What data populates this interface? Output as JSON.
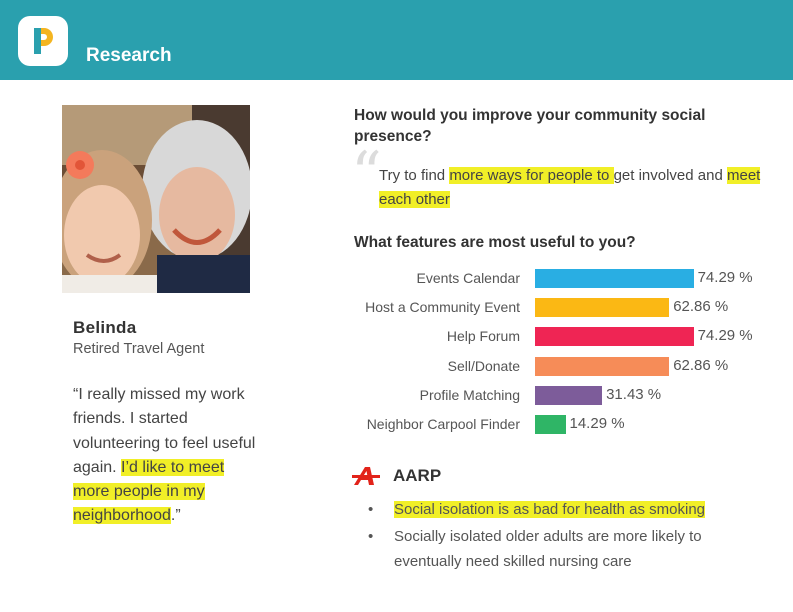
{
  "header": {
    "title": "Research",
    "logo_icon": "p-logo-icon"
  },
  "persona": {
    "name": "Belinda",
    "role": "Retired Travel Agent",
    "quote_plain": "“I really missed my work friends. I started volunteering to feel useful again. ",
    "quote_highlight": "I’d like to  meet more people in my neighborhood",
    "quote_end": ".”"
  },
  "question1": {
    "title": "How would you improve your community social presence?",
    "answer_pre": "Try to find ",
    "answer_hl1": "more ways for people to ",
    "answer_mid": "get involved and ",
    "answer_hl2": "meet each other"
  },
  "question2": {
    "title": "What features are most useful to you?"
  },
  "chart_data": {
    "type": "bar",
    "orientation": "horizontal",
    "categories": [
      "Events Calendar",
      "Host a Community Event",
      "Help Forum",
      "Sell/Donate",
      "Profile Matching",
      "Neighbor Carpool Finder"
    ],
    "values": [
      74.29,
      62.86,
      74.29,
      62.86,
      31.43,
      14.29
    ],
    "value_labels": [
      "74.29 %",
      "62.86 %",
      "74.29 %",
      "62.86 %",
      "31.43 %",
      "14.29 %"
    ],
    "colors": [
      "#29aee3",
      "#fbb814",
      "#ef2554",
      "#f68c58",
      "#7d5c9a",
      "#2fb566"
    ],
    "xlim": [
      0,
      100
    ]
  },
  "aarp": {
    "label": "AARP",
    "icon": "aarp-a-icon",
    "bullet_symbol": "•",
    "bullets": [
      "Social isolation is as bad for health as smoking",
      "Socially isolated older adults are more likely to eventually need skilled nursing care"
    ]
  },
  "colors": {
    "header": "#2aa0ae",
    "highlight": "#f1ef27",
    "aarp_red": "#e2231a"
  }
}
